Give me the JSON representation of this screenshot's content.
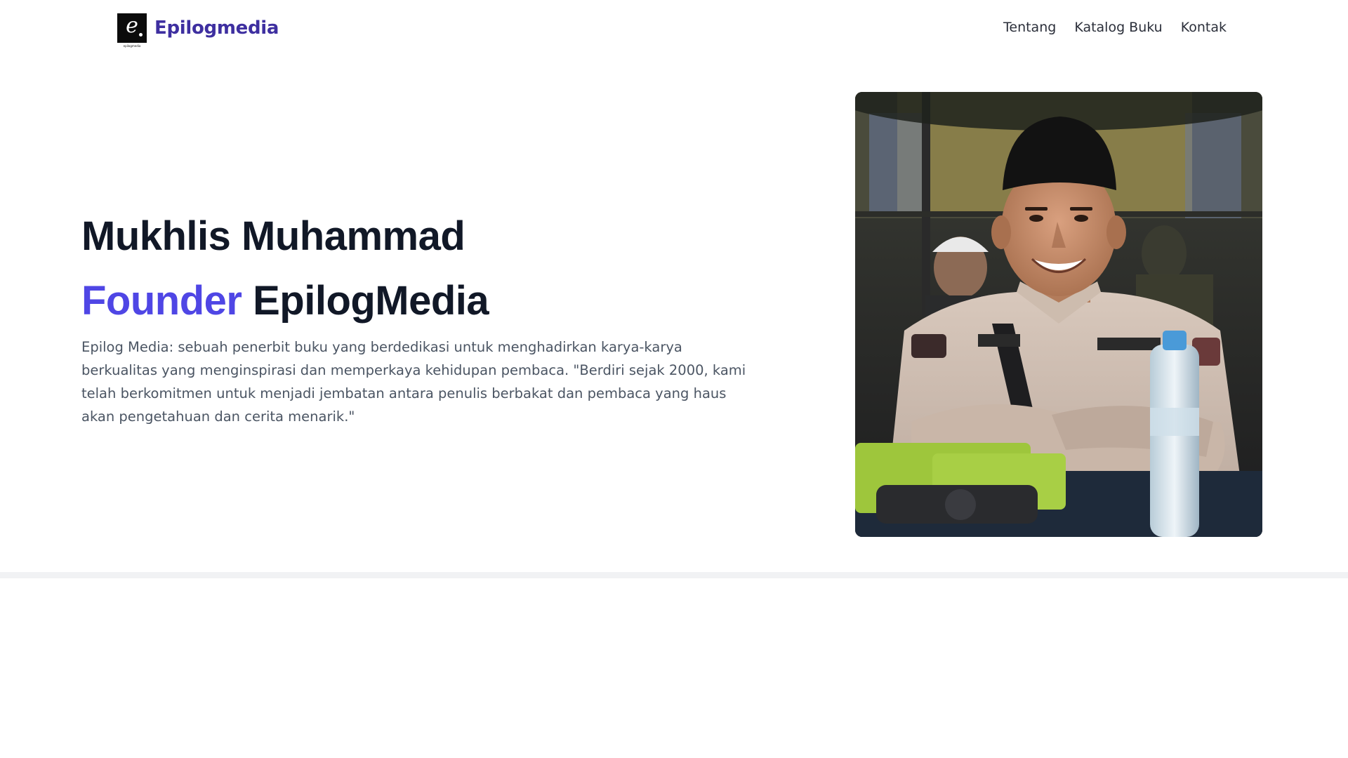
{
  "brand": {
    "name": "Epilogmedia",
    "logo_glyph": "e",
    "logo_caption": "epilogmedia",
    "logo_icon": "epilog-logo-icon"
  },
  "nav": {
    "items": [
      {
        "label": "Tentang"
      },
      {
        "label": "Katalog Buku"
      },
      {
        "label": "Kontak"
      }
    ]
  },
  "hero": {
    "name_line": "Mukhlis Muhammad",
    "role_accent": "Founder",
    "role_rest": " EpilogMedia",
    "description": "Epilog Media: sebuah penerbit buku yang berdedikasi untuk menghadirkan karya-karya berkualitas yang menginspirasi dan memperkaya kehidupan pembaca. \"Berdiri sejak 2000, kami telah berkomitmen untuk menjadi jembatan antara penulis berbakat dan pembaca yang haus akan pengetahuan dan cerita menarik.\"",
    "photo_alt": "Mukhlis Muhammad"
  },
  "colors": {
    "brand": "#3e2fa0",
    "accent": "#4f46e5",
    "heading": "#111827",
    "body_text": "#4b5563"
  }
}
